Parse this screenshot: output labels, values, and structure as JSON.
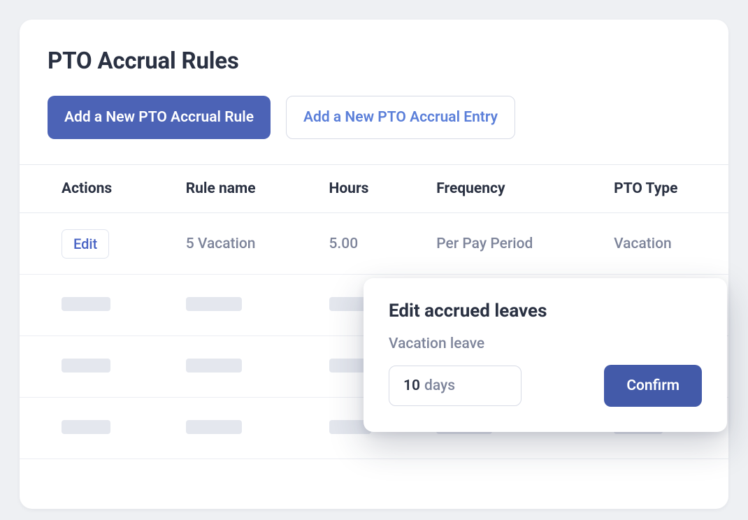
{
  "header": {
    "title": "PTO Accrual Rules"
  },
  "buttons": {
    "add_rule": "Add a New PTO Accrual Rule",
    "add_entry": "Add a New PTO Accrual Entry"
  },
  "table": {
    "headers": {
      "actions": "Actions",
      "rule_name": "Rule name",
      "hours": "Hours",
      "frequency": "Frequency",
      "pto_type": "PTO Type"
    },
    "rows": [
      {
        "edit_label": "Edit",
        "rule_name": "5 Vacation",
        "hours": "5.00",
        "frequency": "Per Pay Period",
        "pto_type": "Vacation"
      }
    ]
  },
  "popover": {
    "title": "Edit accrued leaves",
    "field_label": "Vacation leave",
    "value": "10",
    "unit": "days",
    "confirm_label": "Confirm"
  }
}
